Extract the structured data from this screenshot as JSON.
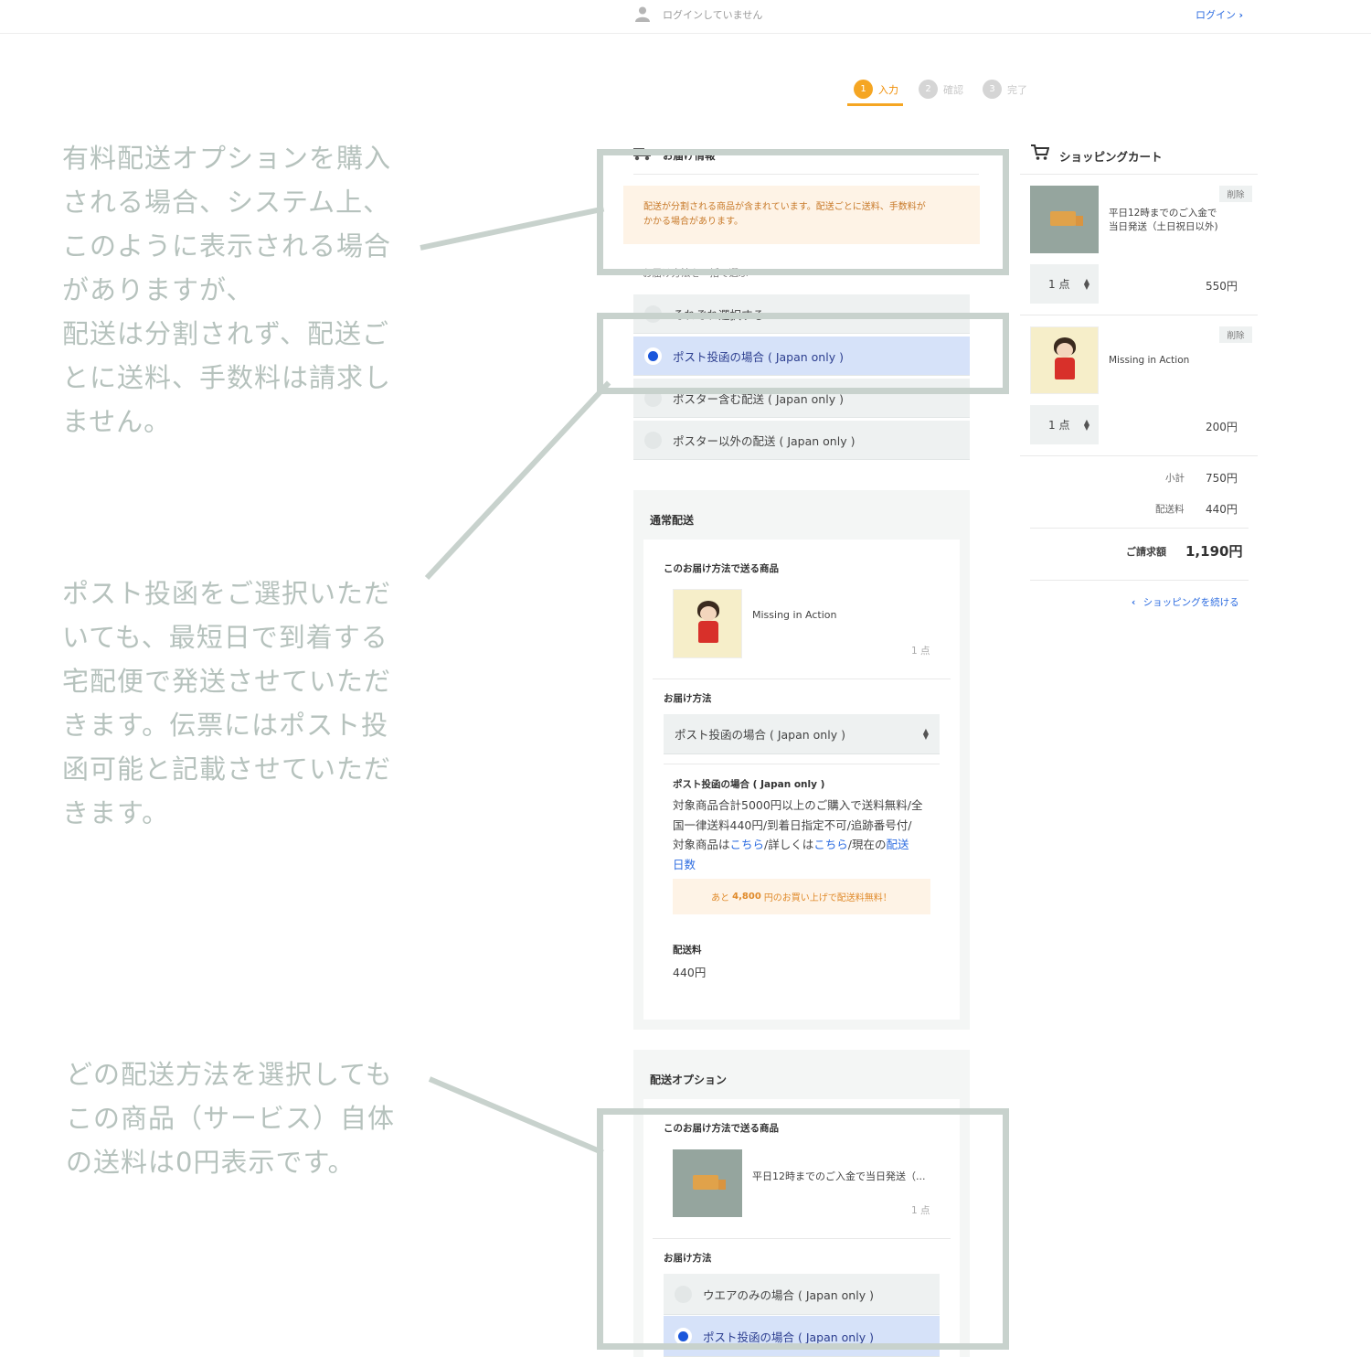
{
  "header": {
    "login_status": "ログインしていません",
    "login_link": "ログイン"
  },
  "steps": [
    {
      "num": "1",
      "label": "入力",
      "state": "active"
    },
    {
      "num": "2",
      "label": "確認",
      "state": "inactive"
    },
    {
      "num": "3",
      "label": "完了",
      "state": "inactive"
    }
  ],
  "annotations": {
    "a1_lines": [
      "有料配送オプションを購入",
      "される場合、システム上、",
      "このように表示される場合",
      "がありますが、",
      "配送は分割されず、配送ご",
      "とに送料、手数料は請求し",
      "ません。"
    ],
    "a2_lines": [
      "ポスト投函をご選択いただ",
      "いても、最短日で到着する",
      "宅配便で発送させていただ",
      "きます。伝票にはポスト投",
      "函可能と記載させていただ",
      "きます。"
    ],
    "a3_lines": [
      "どの配送方法を選択しても",
      "この商品（サービス）自体",
      "の送料は0円表示です。"
    ]
  },
  "delivery": {
    "title": "お届け情報",
    "notice_line1": "配送が分割される商品が含まれています。配送ごとに送料、手数料が",
    "notice_line2": "かかる場合があります。",
    "bulk_label": "お届け方法を一括で選ぶ",
    "bulk_options": [
      {
        "label": "それぞれ選択する",
        "selected": false
      },
      {
        "label": "ポスト投函の場合 ( Japan only )",
        "selected": true
      },
      {
        "label": "ポスター含む配送 ( Japan only )",
        "selected": false
      },
      {
        "label": "ポスター以外の配送 ( Japan only )",
        "selected": false
      }
    ]
  },
  "normal_shipping": {
    "title": "通常配送",
    "items_label": "このお届け方法で送る商品",
    "item_name": "Missing in Action",
    "item_qty": "1 点",
    "method_label": "お届け方法",
    "method_value": "ポスト投函の場合 ( Japan only )",
    "method_desc_title": "ポスト投函の場合 ( Japan only )",
    "desc_line1": "対象商品合計5000円以上のご購入で送料無料/全",
    "desc_line2": "国一律送料440円/到着日指定不可/追跡番号付/",
    "desc_line3_pre": "対象商品は",
    "desc_link1": "こちら",
    "desc_line3_mid": "/詳しくは",
    "desc_link2": "こちら",
    "desc_line3_post": "/現在の",
    "desc_link3a": "配送",
    "desc_link3b": "日数",
    "free_pre": "あと",
    "free_amount": "4,800",
    "free_post": "円のお買い上げで配送料無料！",
    "fee_label": "配送料",
    "fee_value": "440円"
  },
  "option_shipping": {
    "title": "配送オプション",
    "items_label": "このお届け方法で送る商品",
    "item_name": "平日12時までのご入金で当日発送（...",
    "item_qty": "1 点",
    "method_label": "お届け方法",
    "options": [
      {
        "label": "ウエアのみの場合 ( Japan only )",
        "selected": false
      },
      {
        "label": "ポスト投函の場合 ( Japan only )",
        "selected": true
      }
    ]
  },
  "cart": {
    "title": "ショッピングカート",
    "delete_label": "削除",
    "items": [
      {
        "name_line1": "平日12時までのご入金で",
        "name_line2": "当日発送（土日祝日以外)",
        "qty": "1 点",
        "price": "550円"
      },
      {
        "name_line1": "Missing in Action",
        "name_line2": "",
        "qty": "1 点",
        "price": "200円"
      }
    ],
    "subtotal_label": "小計",
    "subtotal": "750円",
    "shipping_label": "配送料",
    "shipping": "440円",
    "total_label": "ご請求額",
    "total": "1,190円",
    "continue_label": "ショッピングを続ける"
  },
  "colors": {
    "accent": "#f5a623",
    "link": "#2b6be0",
    "selected_row": "#d6e2f9",
    "annotation": "#b6c2bd"
  }
}
